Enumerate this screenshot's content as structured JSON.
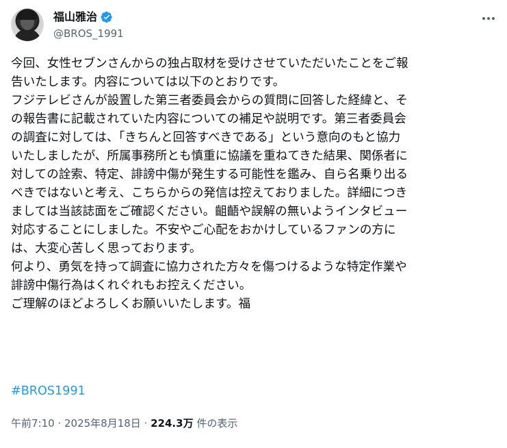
{
  "author": {
    "display_name": "福山雅治",
    "handle": "@BROS_1991"
  },
  "icons": {
    "avatar": "profile-photo",
    "verified": "verified-badge-icon",
    "more": "more-options-icon"
  },
  "colors": {
    "link": "#1d9bf0",
    "secondary_text": "#536471",
    "primary_text": "#0f1419"
  },
  "post": {
    "lines": [
      "今回、女性セブンさんからの独占取材を受けさせていただいたことをご報",
      "告いたします。内容については以下のとおりです。",
      "フジテレビさんが設置した第三者委員会からの質問に回答した経緯と、そ",
      "の報告書に記載されていた内容についての補足や説明です。第三者委員会",
      "の調査に対しては、「きちんと回答すべきである」という意向のもと協力",
      "いたしましたが、所属事務所とも慎重に協議を重ねてきた結果、関係者に",
      "対しての詮索、特定、誹謗中傷が発生する可能性を鑑み、自ら名乗り出る",
      "べきではないと考え、こちらからの発信は控えておりました。詳細につき",
      "ましては当該誌面をご確認ください。齟齬や誤解の無いようインタビュー",
      "対応することにしました。不安やご心配をおかけしているファンの方に",
      "は、大変心苦しく思っております。",
      "何より、勇気を持って調査に協力された方々を傷つけるような特定作業や",
      "誹謗中傷行為はくれぐれもお控えください。",
      "ご理解のほどよろしくお願いいたします。福"
    ],
    "hashtag": "#BROS1991"
  },
  "meta": {
    "time": "午前7:10",
    "separator": " · ",
    "date": "2025年8月18日",
    "views_count": "224.3万",
    "views_label": " 件の表示"
  }
}
